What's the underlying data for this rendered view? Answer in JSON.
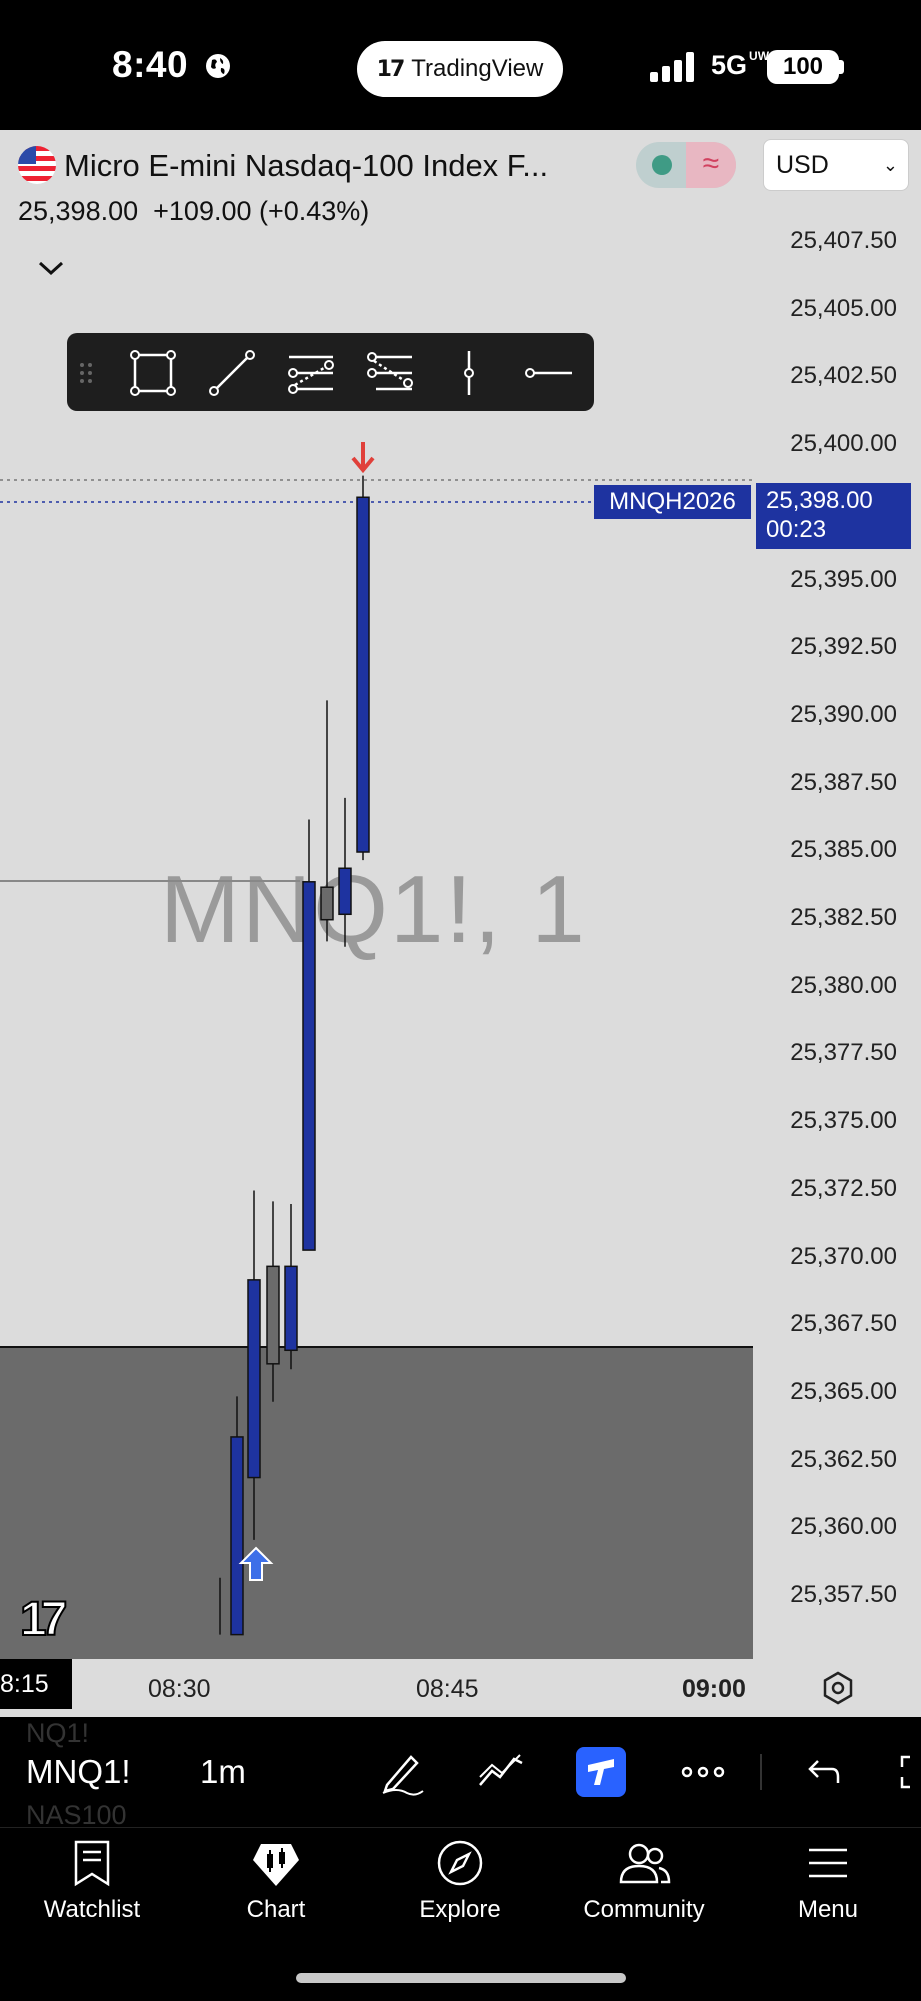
{
  "status_bar": {
    "time": "8:40",
    "app_pill": "TradingView",
    "network": "5G",
    "network_sub": "UW",
    "battery": "100"
  },
  "header": {
    "symbol_title": "Micro E-mini Nasdaq-100 Index F...",
    "last_price": "25,398.00",
    "change": "+109.00 (+0.43%)",
    "currency": "USD"
  },
  "chart": {
    "watermark": "MNQ1!, 1",
    "price_ticks": [
      "25,407.50",
      "25,405.00",
      "25,402.50",
      "25,400.00",
      "25,395.00",
      "25,392.50",
      "25,390.00",
      "25,387.50",
      "25,385.00",
      "25,382.50",
      "25,380.00",
      "25,377.50",
      "25,375.00",
      "25,372.50",
      "25,370.00",
      "25,367.50",
      "25,365.00",
      "25,362.50",
      "25,360.00",
      "25,357.50"
    ],
    "price_label": {
      "contract": "MNQH2026",
      "price": "25,398.00",
      "countdown": "00:23"
    },
    "time_ticks": [
      "08:30",
      "08:45",
      "09:00"
    ],
    "time_current": "8:15",
    "colors": {
      "up": "#1e33a0",
      "neutral": "#6b6b6b",
      "sell_arrow": "#e0403a",
      "buy_arrow": "#3d6fe8"
    }
  },
  "chart_data": {
    "type": "candlestick",
    "symbol": "MNQ1!",
    "interval": "1",
    "ylim": [
      25356,
      25408.5
    ],
    "x_ticks": [
      "08:30",
      "08:45",
      "09:00"
    ],
    "candles": [
      {
        "x": 0,
        "open": 25357.0,
        "close": 25357.0,
        "high": 25358.1,
        "low": 25356.0,
        "color": "none"
      },
      {
        "x": 1,
        "open": 25356.0,
        "close": 25363.3,
        "high": 25364.8,
        "low": 25356.0,
        "color": "up"
      },
      {
        "x": 2,
        "open": 25361.8,
        "close": 25369.1,
        "high": 25372.4,
        "low": 25359.5,
        "color": "up"
      },
      {
        "x": 3,
        "open": 25366.0,
        "close": 25369.6,
        "high": 25372.0,
        "low": 25364.6,
        "color": "neutral"
      },
      {
        "x": 4,
        "open": 25366.5,
        "close": 25369.6,
        "high": 25371.9,
        "low": 25365.8,
        "color": "up"
      },
      {
        "x": 5,
        "open": 25370.2,
        "close": 25383.8,
        "high": 25386.1,
        "low": 25370.2,
        "color": "up"
      },
      {
        "x": 6,
        "open": 25382.4,
        "close": 25383.6,
        "high": 25390.5,
        "low": 25381.6,
        "color": "neutral"
      },
      {
        "x": 7,
        "open": 25382.6,
        "close": 25384.3,
        "high": 25386.9,
        "low": 25381.4,
        "color": "up"
      },
      {
        "x": 8,
        "open": 25384.9,
        "close": 25398.0,
        "high": 25398.8,
        "low": 25384.6,
        "color": "up"
      }
    ]
  },
  "drawing_toolbar": {
    "tools": [
      "rectangle-icon",
      "trend-line-icon",
      "long-position-icon",
      "short-position-icon",
      "vertical-line-icon",
      "horizontal-ray-icon"
    ]
  },
  "chart_toolbar": {
    "symbol": "MNQ1!",
    "interval": "1m",
    "ghost_above": "NQ1!",
    "ghost_below": "NAS100"
  },
  "bottom_nav": {
    "items": [
      "Watchlist",
      "Chart",
      "Explore",
      "Community",
      "Menu"
    ]
  }
}
